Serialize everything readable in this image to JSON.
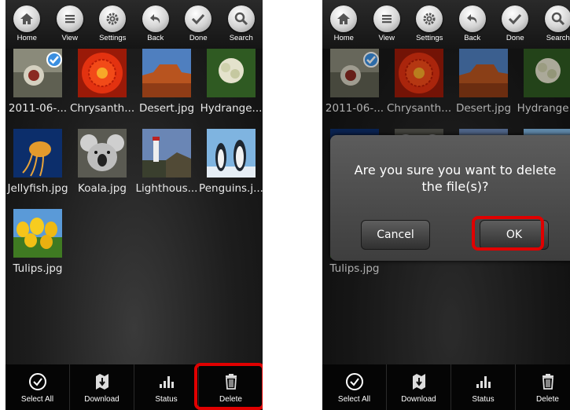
{
  "toolbar": {
    "items": [
      {
        "label": "Home",
        "icon": "home-icon"
      },
      {
        "label": "View",
        "icon": "list-icon"
      },
      {
        "label": "Settings",
        "icon": "gear-icon"
      },
      {
        "label": "Back",
        "icon": "back-arrow-icon"
      },
      {
        "label": "Done",
        "icon": "checkmark-icon"
      },
      {
        "label": "Search",
        "icon": "search-icon"
      }
    ]
  },
  "files": [
    {
      "name": "2011-06-...",
      "selected": true
    },
    {
      "name": "Chrysanth..."
    },
    {
      "name": "Desert.jpg"
    },
    {
      "name": "Hydrange..."
    },
    {
      "name": "Jellyfish.jpg"
    },
    {
      "name": "Koala.jpg"
    },
    {
      "name": "Lighthous..."
    },
    {
      "name": "Penguins.j..."
    },
    {
      "name": "Tulips.jpg"
    }
  ],
  "bottombar": {
    "items": [
      {
        "label": "Select All",
        "icon": "check-circle-icon"
      },
      {
        "label": "Download",
        "icon": "download-icon"
      },
      {
        "label": "Status",
        "icon": "bar-chart-icon"
      },
      {
        "label": "Delete",
        "icon": "trash-icon"
      }
    ]
  },
  "dialog": {
    "message": "Are you sure you want to delete the file(s)?",
    "cancel": "Cancel",
    "ok": "OK"
  },
  "colors": {
    "highlight": "#e00000",
    "selected_badge": "#3b8fe0"
  }
}
